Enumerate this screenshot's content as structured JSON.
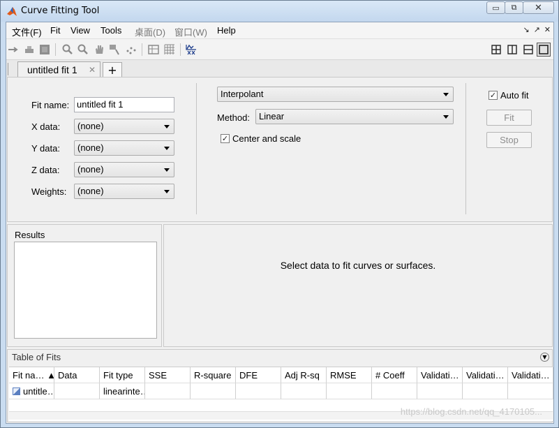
{
  "window": {
    "title": "Curve Fitting Tool",
    "buttons": {
      "minimize": "▭",
      "restore": "⧉",
      "close": "✕"
    }
  },
  "menu": {
    "items": [
      {
        "label": "文件(F)",
        "dim": false
      },
      {
        "label": "Fit",
        "dim": false
      },
      {
        "label": "View",
        "dim": false
      },
      {
        "label": "Tools",
        "dim": false
      },
      {
        "label": "桌面(D)",
        "dim": true
      },
      {
        "label": "窗口(W)",
        "dim": true
      },
      {
        "label": "Help",
        "dim": false
      }
    ],
    "right_controls": {
      "dock": "↘",
      "undock": "↗",
      "close": "✕"
    }
  },
  "toolbar": {
    "icons": [
      "data-cursor-icon",
      "exclude-icon",
      "legend-icon",
      "zoom-in-icon",
      "zoom-out-icon",
      "pan-icon",
      "data-cursor-icon-2",
      "exclude-outliers-icon",
      "table-icon",
      "grid-icon",
      "residuals-icon"
    ],
    "layout_buttons": [
      "tile-icon",
      "split-vertical-icon",
      "split-horizontal-icon",
      "single-view-icon"
    ]
  },
  "tabs": {
    "active_label": "untitled fit 1",
    "close_glyph": "✕",
    "add_glyph": "+"
  },
  "fit_panel": {
    "fit_name_label": "Fit name:",
    "fit_name_value": "untitled fit 1",
    "x_label": "X data:",
    "x_value": "(none)",
    "y_label": "Y data:",
    "y_value": "(none)",
    "z_label": "Z data:",
    "z_value": "(none)",
    "weights_label": "Weights:",
    "weights_value": "(none)",
    "fit_type_value": "Interpolant",
    "method_label": "Method:",
    "method_value": "Linear",
    "center_scale_label": "Center and scale",
    "center_scale_checked": "✓",
    "auto_fit_label": "Auto fit",
    "auto_fit_checked": "✓",
    "fit_button": "Fit",
    "stop_button": "Stop"
  },
  "results": {
    "title": "Results"
  },
  "plot": {
    "message": "Select data to fit curves or surfaces."
  },
  "table_of_fits": {
    "title": "Table of Fits",
    "collapse_glyph": "▼",
    "columns": [
      "Fit na… ▲",
      "Data",
      "Fit type",
      "SSE",
      "R-square",
      "DFE",
      "Adj R-sq",
      "RMSE",
      "# Coeff",
      "Validati…",
      "Validati…",
      "Validati…"
    ],
    "rows": [
      [
        "untitle…",
        "",
        "linearinte…",
        "",
        "",
        "",
        "",
        "",
        "",
        "",
        "",
        ""
      ]
    ]
  },
  "watermark": "https://blog.csdn.net/qq_4170105..."
}
